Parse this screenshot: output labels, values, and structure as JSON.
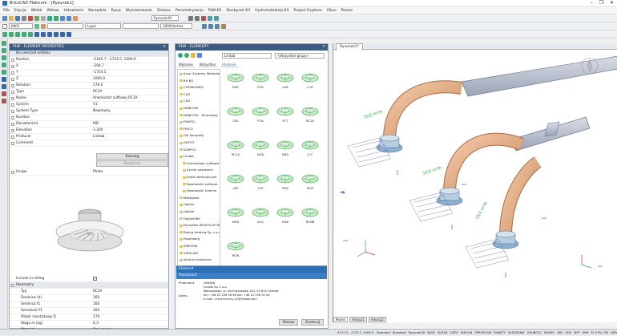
{
  "window": {
    "title": "BricsCAD Platinum - [Rysunek1]",
    "controls": [
      "–",
      "❐",
      "✕"
    ]
  },
  "menu": [
    "Plik",
    "Edycja",
    "Widok",
    "Wstaw",
    "Ustawienia",
    "Narzędzia",
    "Rysuj",
    "Wymiarowanie",
    "Zmiana",
    "Parametryzacja",
    "PLW-K3",
    "Sterbycek K3",
    "Hydroinstalacja K3",
    "Project Explorer",
    "Okno",
    "Pomoc"
  ],
  "toolbar": {
    "layer_combo": "Rysunek-M",
    "linetype_combo": "Layer",
    "style_combo": "KKO1",
    "dimstyle_combo": "1000/Vertive"
  },
  "properties_panel": {
    "title": "PLW - ELEMENT PROPERTIES",
    "selection": "No selected entities",
    "rows": [
      {
        "key": "Position",
        "value": "-1165.7, -1724.5, 1000.0"
      },
      {
        "key": "X",
        "value": "-294.7"
      },
      {
        "key": "Y",
        "value": "-1724.5"
      },
      {
        "key": "Z",
        "value": "1000.0"
      },
      {
        "key": "Rotation",
        "value": "176.6"
      },
      {
        "key": "Type",
        "value": "RC1A"
      },
      {
        "key": "Name",
        "value": "Anemostat sufitowy RC1A"
      },
      {
        "key": "System",
        "value": "V1"
      },
      {
        "key": "System Type",
        "value": "Nawiewny"
      },
      {
        "key": "Number",
        "value": ""
      },
      {
        "key": "Elevation(m)",
        "value": "MD"
      },
      {
        "key": "Elevation",
        "value": "3.300"
      },
      {
        "key": "Producer",
        "value": "Lindab"
      },
      {
        "key": "Comment",
        "value": ""
      }
    ],
    "catalog_button": "Katalog",
    "reset_button": "Reset kat",
    "image_label": "Image",
    "image_value": "Photo",
    "include_label": "Include in listing",
    "params_label": "Parametry",
    "params": [
      {
        "key": "Typ",
        "value": "RC1A"
      },
      {
        "key": "Średnica (d)",
        "value": "160"
      },
      {
        "key": "Średnica f1",
        "value": "160"
      },
      {
        "key": "Szerokość f1",
        "value": "160"
      },
      {
        "key": "Otwór montażowy D",
        "value": "170"
      },
      {
        "key": "Waga m (kg)",
        "value": "0,3"
      },
      {
        "key": "Materiał",
        "value": "Stal ocynk."
      }
    ]
  },
  "elements_panel": {
    "title": "PLW - ELEMENTY",
    "manufacturer_select": "Lindab",
    "group_select": "<Wszystkie grupy>",
    "tabs": [
      "Wybrane",
      "Wszystkie",
      "Ulubione"
    ],
    "tree": [
      "Alnor Systemy Wentylacji",
      "BH BG",
      "CHEMKOMEX",
      "CIAT",
      "CIAT",
      "DANFOSS",
      "DANFOSS - Termostaty",
      "FRAPOL",
      "FRICO",
      "GKI Komplety",
      "GRYFIT",
      "KAMPOL",
      "Lindab",
      "Anemostaty sufitowe",
      "Żyrafa nawiewne",
      "Kratki wentylacyjne",
      "Nawiewniki sufitowe",
      "Nawiewniki ścienne",
      "Metalplast",
      "Ogólne",
      "Ogólne",
      "OgólneSBS",
      "Panvoflex WENTYLATOR",
      "Rating Heating Sp. z o.o.",
      "Rosenberg",
      "SWEGON",
      "VENA AIR",
      "Venture Industries",
      "Zehnder"
    ],
    "grid": [
      "RKR",
      "PCR",
      "LKR",
      "LCR",
      "CKL",
      "PCA",
      "PCT",
      "RC1A",
      "RC1X",
      "NCB",
      "NSQ",
      "LCC",
      "LKP",
      "LCP",
      "PSQ",
      "RGH",
      "NCB",
      "KLG",
      "KGB",
      "RCNB",
      "RCW"
    ],
    "element_bar": "Element",
    "producer_bar": "Producent",
    "producer_label": "Producent",
    "producer_name": "LINDAB",
    "producer_address_label": "Adres",
    "producer_address": [
      "Lindab Sp. z o.o.",
      "Warszawska, ul. Sochaczewska 144, 05-850 Ożarów",
      "tel.: +48 22 256 56 56 fax: +48 22 256 92 60",
      "e-mail: ul.techniczny-22@lindab.com"
    ],
    "insert_button": "Wstaw",
    "close_button": "Zamknij"
  },
  "viewport": {
    "tab": "Rysunek1*",
    "flow_label": "15/2 m³/h",
    "model_tabs": [
      "Model",
      "Arkusz1",
      "Arkusz2"
    ]
  },
  "statusbar": [
    "Standard",
    "Standard",
    "Rysunek1B",
    "SKOK",
    "SIATKA",
    "ORTO",
    "BIEGUN",
    "ZPRZYCHW",
    "RUNETY",
    "SLEDZENIE",
    "GRUBOSC",
    "MODEL",
    "DIN",
    "ODS",
    "MFP",
    "DYN",
    "PL-STR-17M",
    "NIEWIDOCZNE"
  ],
  "coords": "-4717.5, -1707.2, 1000.0"
}
